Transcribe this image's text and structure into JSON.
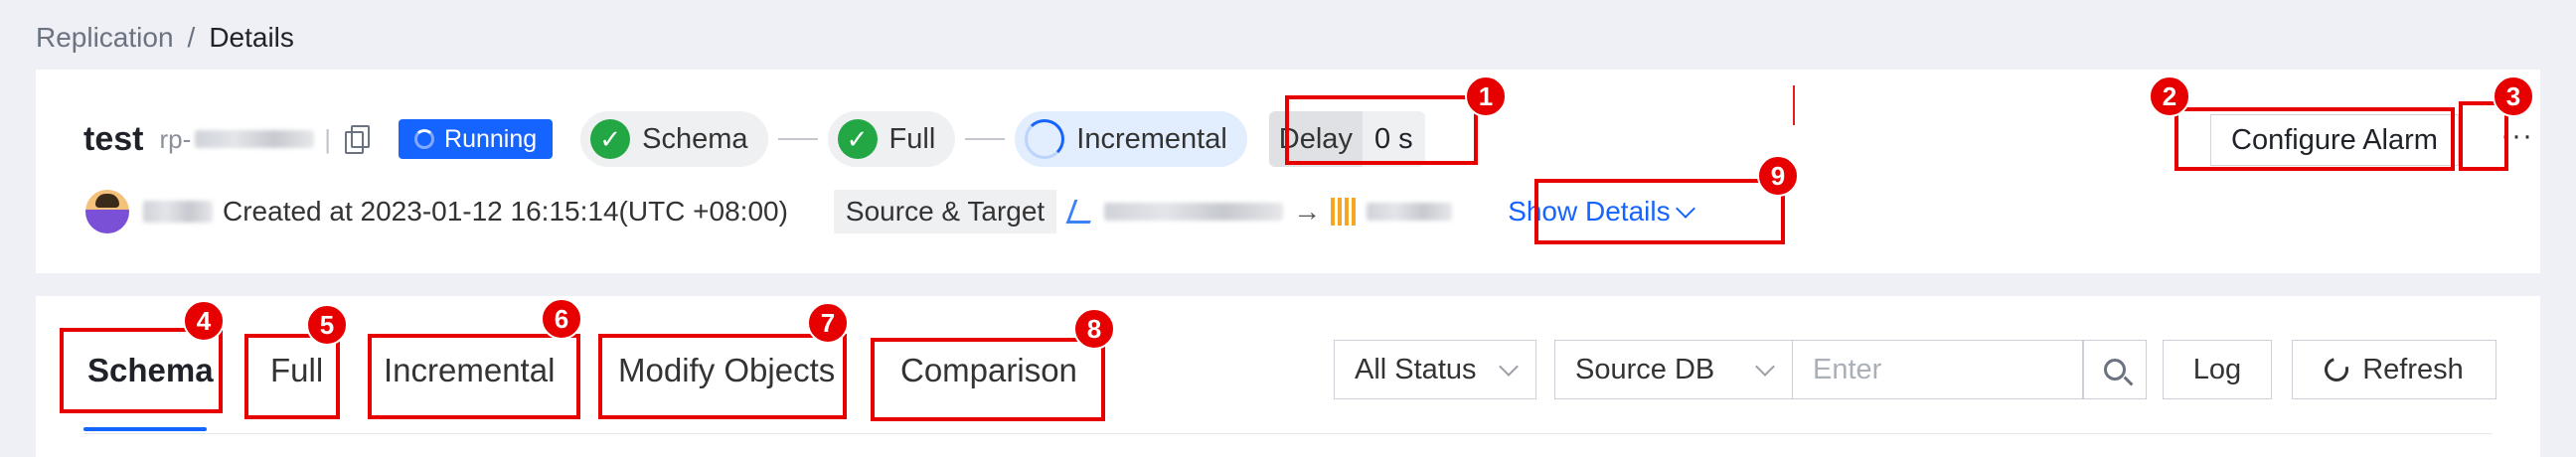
{
  "breadcrumb": {
    "parent": "Replication",
    "separator": "/",
    "current": "Details"
  },
  "task": {
    "name": "test",
    "id_prefix": "rp-",
    "status": "Running",
    "stages": [
      {
        "label": "Schema",
        "state": "done"
      },
      {
        "label": "Full",
        "state": "done"
      },
      {
        "label": "Incremental",
        "state": "in-progress"
      }
    ],
    "delay_label": "Delay",
    "delay_value": "0 s",
    "created": "Created at 2023-01-12 16:15:14(UTC +08:00)",
    "source_target_label": "Source & Target",
    "show_details": "Show Details"
  },
  "actions": {
    "configure_alarm": "Configure Alarm",
    "more": "···"
  },
  "tabs": [
    "Schema",
    "Full",
    "Incremental",
    "Modify Objects",
    "Comparison"
  ],
  "active_tab": "Schema",
  "filters": {
    "status": "All Status",
    "db": "Source DB",
    "search_placeholder": "Enter",
    "log": "Log",
    "refresh": "Refresh"
  },
  "markers": [
    "1",
    "2",
    "3",
    "4",
    "5",
    "6",
    "7",
    "8",
    "9"
  ],
  "colors": {
    "primary": "#1664ff",
    "success": "#23a745",
    "marker": "#e60000"
  }
}
